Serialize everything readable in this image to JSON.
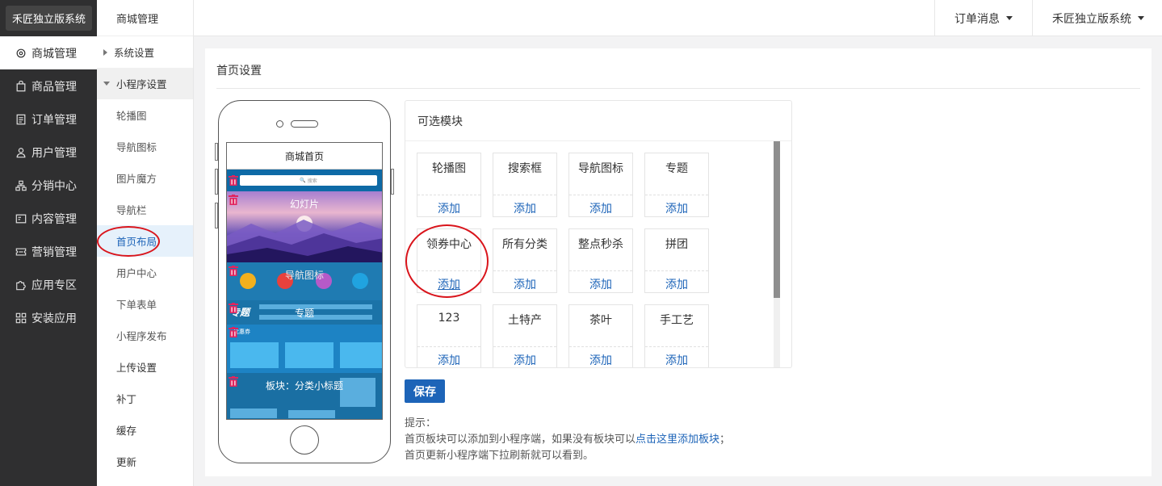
{
  "brand": "禾匠独立版系统",
  "nav": [
    {
      "label": "商城管理",
      "icon": "gear-icon"
    },
    {
      "label": "商品管理",
      "icon": "bag-icon"
    },
    {
      "label": "订单管理",
      "icon": "list-icon"
    },
    {
      "label": "用户管理",
      "icon": "user-icon"
    },
    {
      "label": "分销中心",
      "icon": "network-icon"
    },
    {
      "label": "内容管理",
      "icon": "content-icon"
    },
    {
      "label": "营销管理",
      "icon": "ticket-icon"
    },
    {
      "label": "应用专区",
      "icon": "puzzle-icon"
    },
    {
      "label": "安装应用",
      "icon": "grid-icon"
    }
  ],
  "subnav": {
    "header": "商城管理",
    "groups": [
      "系统设置",
      "小程序设置"
    ],
    "items": [
      "轮播图",
      "导航图标",
      "图片魔方",
      "导航栏",
      "首页布局",
      "用户中心",
      "下单表单",
      "小程序发布",
      "上传设置",
      "补丁",
      "缓存",
      "更新"
    ]
  },
  "topbar": {
    "messages": "订单消息",
    "system": "禾匠独立版系统"
  },
  "page": {
    "title": "首页设置"
  },
  "phone": {
    "screen_title": "商城首页",
    "search_placeholder": "搜索",
    "blocks": {
      "slide": "幻灯片",
      "nav": "导航图标",
      "topic_mark": "专题",
      "topic": "专题",
      "coupon": "优惠券",
      "tabs": "板块：分类小标题"
    }
  },
  "modules": {
    "title": "可选模块",
    "add_label": "添加",
    "items": [
      "轮播图",
      "搜索框",
      "导航图标",
      "专题",
      "领券中心",
      "所有分类",
      "整点秒杀",
      "拼团",
      "123",
      "土特产",
      "茶叶",
      "手工艺"
    ]
  },
  "save_label": "保存",
  "tips": {
    "heading": "提示：",
    "line1_pre": "首页板块可以添加到小程序端，如果没有板块可以",
    "line1_link": "点击这里添加板块",
    "line1_post": "；",
    "line2": "首页更新小程序端下拉刷新就可以看到。"
  },
  "colors": {
    "sidebar_bg": "#2f2f30",
    "accent": "#1d64b8",
    "annotation": "#d9141b",
    "delete": "#e0245e"
  }
}
